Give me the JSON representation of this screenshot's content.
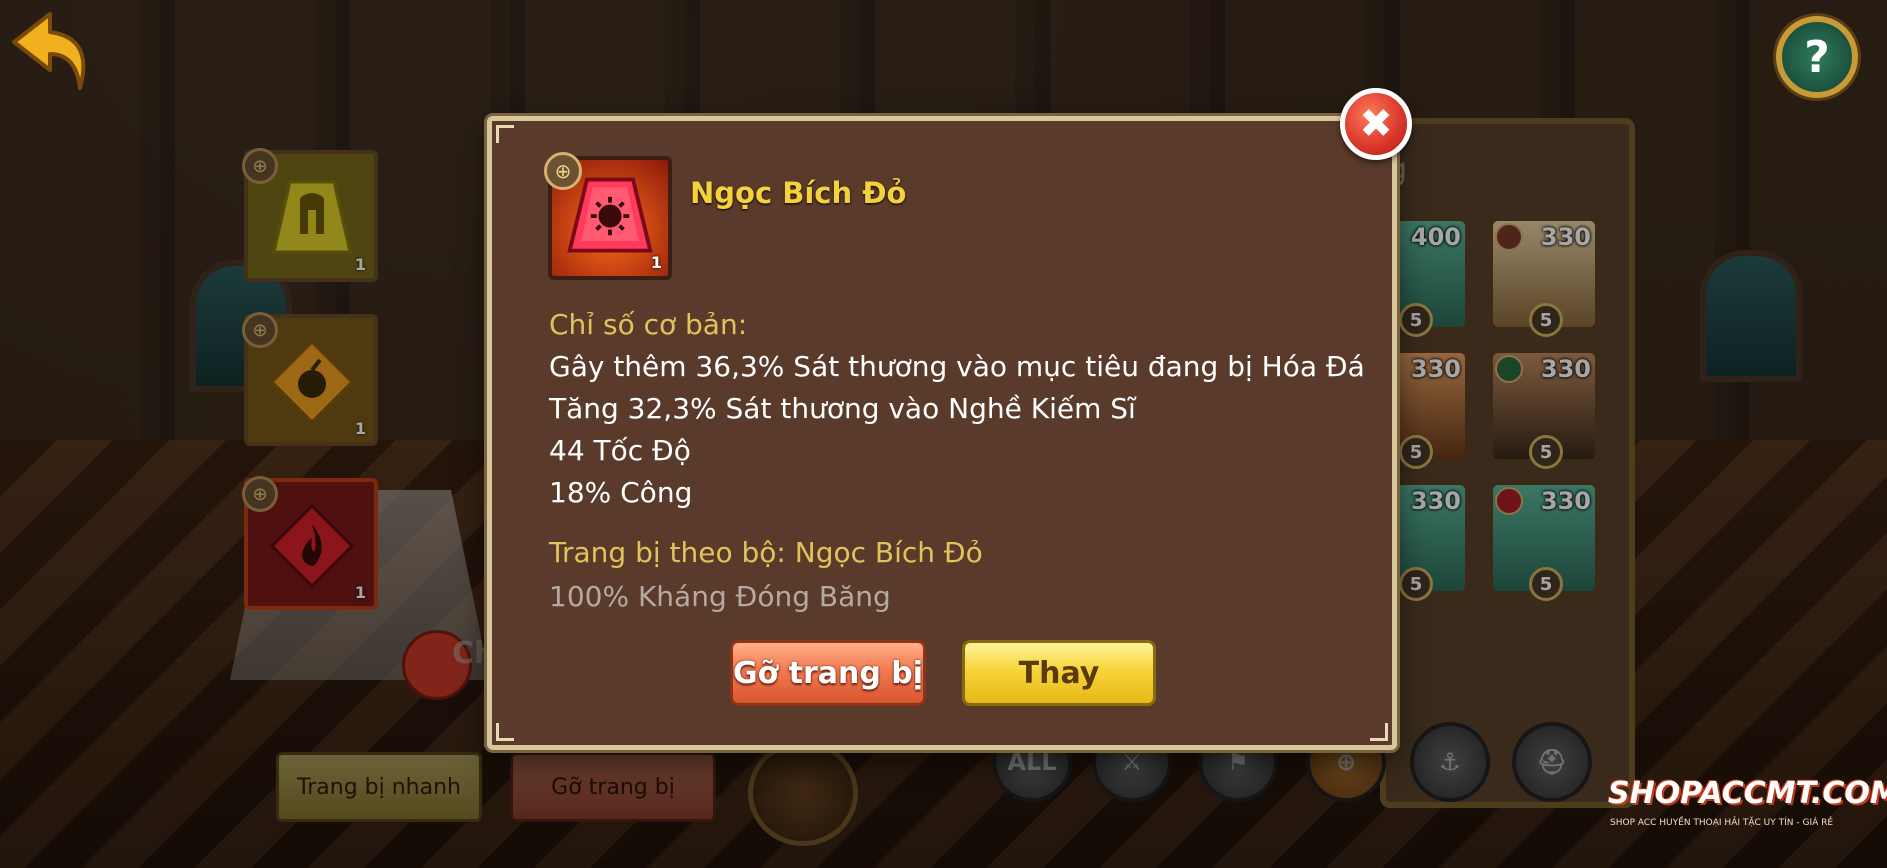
{
  "colors": {
    "modal_bg": "#5a3a2b",
    "modal_border": "#d9c79c",
    "item_name": "#f5d23a",
    "section_label": "#e2c25a",
    "stat_text": "#ffffff",
    "set_bonus_text": "#b4aaa2",
    "unequip_button": "#f27a52",
    "replace_button": "#f7d43a",
    "close_button": "#d8352a"
  },
  "top": {
    "back_icon": "back-arrow-icon",
    "help_label": "?"
  },
  "equipment_slots": [
    {
      "icon": "helmet-gem-icon",
      "color": "#d8c82a",
      "count": "1"
    },
    {
      "icon": "bomb-gem-icon",
      "color": "#e89a1a",
      "count": "1"
    },
    {
      "icon": "flame-gem-icon",
      "color": "#c8202a",
      "count": "1"
    }
  ],
  "stage": {
    "fragment_text": "Ch"
  },
  "bottom_buttons": {
    "quick_equip": "Trang bị nhanh",
    "remove": "Gỡ trang bị"
  },
  "hero_panel": {
    "title_fragment": "g",
    "heroes": [
      {
        "level": "400",
        "stars": "5"
      },
      {
        "level": "330",
        "stars": "5"
      },
      {
        "level": "330",
        "stars": "5"
      },
      {
        "level": "330",
        "stars": "5"
      },
      {
        "level": "330",
        "stars": "5"
      },
      {
        "level": "330",
        "stars": "5"
      }
    ],
    "filters": [
      "ALL",
      "sword-icon",
      "flag-icon",
      "target-icon",
      "anchor-icon",
      "helmet-icon"
    ]
  },
  "modal": {
    "item": {
      "name": "Ngọc Bích Đỏ",
      "count": "1",
      "icon": "red-gem-icon"
    },
    "base_stats_label": "Chỉ số cơ bản:",
    "stats": [
      "Gây thêm 36,3% Sát thương vào mục tiêu đang bị Hóa Đá",
      "Tăng 32,3% Sát thương vào Nghề Kiếm Sĩ",
      "44 Tốc Độ",
      "18% Công"
    ],
    "set_label": "Trang bị theo bộ: Ngọc Bích Đỏ",
    "set_bonus": "100% Kháng Đóng Băng",
    "unequip_label": "Gỡ trang bị",
    "replace_label": "Thay",
    "close_icon": "close-icon"
  },
  "watermark": {
    "logo": "SHOPACCMT.COM",
    "tagline": "SHOP ACC HUYỀN THOẠI HẢI TẶC UY TÍN - GIÁ RẺ"
  }
}
